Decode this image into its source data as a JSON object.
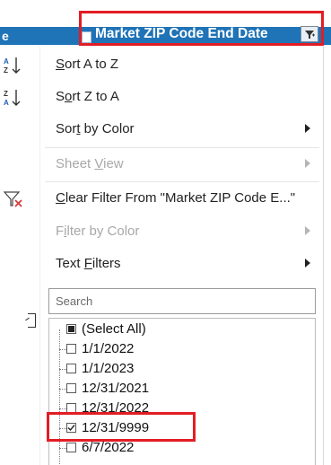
{
  "header": {
    "left_fragment": "e",
    "title": "Market ZIP Code End Date",
    "filter_icon": "filter-active-icon"
  },
  "menu": {
    "sort_az": {
      "label": "Sort A to Z",
      "icon": "sort-ascending-icon",
      "underline_char": "S"
    },
    "sort_za": {
      "label": "Sort Z to A",
      "icon": "sort-descending-icon",
      "underline_char": "o"
    },
    "sort_color": {
      "label": "Sort by Color",
      "underline_char": "t"
    },
    "sheet_view": {
      "label": "Sheet View",
      "underline_char": "V",
      "disabled": true
    },
    "clear_filter": {
      "label": "Clear Filter From \"Market ZIP Code E...\"",
      "icon": "clear-filter-icon",
      "underline_char": "C"
    },
    "filter_color": {
      "label": "Filter by Color",
      "underline_char": "i",
      "disabled": true
    },
    "text_filters": {
      "label": "Text Filters",
      "underline_char": "F"
    }
  },
  "search": {
    "placeholder": "Search"
  },
  "values_list": [
    {
      "label": "(Select All)",
      "state": "partial"
    },
    {
      "label": "1/1/2022",
      "state": "unchecked"
    },
    {
      "label": "1/1/2023",
      "state": "unchecked"
    },
    {
      "label": "12/31/2021",
      "state": "unchecked"
    },
    {
      "label": "12/31/2022",
      "state": "unchecked"
    },
    {
      "label": "12/31/9999",
      "state": "checked"
    },
    {
      "label": "6/7/2022",
      "state": "unchecked"
    }
  ],
  "colors": {
    "header": "#1f73b7",
    "highlight": "#e21d24",
    "clear_filter_x": "#d83b3b"
  }
}
